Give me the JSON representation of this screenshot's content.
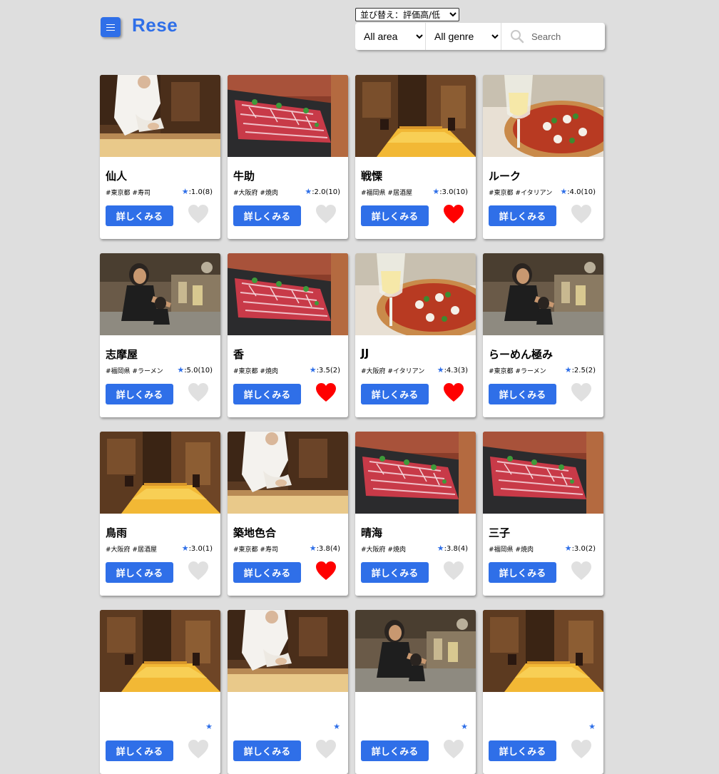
{
  "header": {
    "logo": "Rese",
    "sort_selected": "並び替え：評価高/低",
    "area_selected": "All area",
    "genre_selected": "All genre",
    "search_placeholder": "Search"
  },
  "detail_label": "詳しくみる",
  "colors": {
    "accent": "#2f6fe8",
    "heart_on": "#ff0000",
    "heart_off": "#e0e0e0"
  },
  "shops": [
    {
      "name": "仙人",
      "tags": "#東京都 #寿司",
      "score": ":1.0(8)",
      "photo": "sushi",
      "favorite": false
    },
    {
      "name": "牛助",
      "tags": "#大阪府 #焼肉",
      "score": ":2.0(10)",
      "photo": "yakiniku",
      "favorite": false
    },
    {
      "name": "戦慄",
      "tags": "#福岡県 #居酒屋",
      "score": ":3.0(10)",
      "photo": "izakaya",
      "favorite": true
    },
    {
      "name": "ルーク",
      "tags": "#東京都 #イタリアン",
      "score": ":4.0(10)",
      "photo": "italian",
      "favorite": false
    },
    {
      "name": "志摩屋",
      "tags": "#福岡県 #ラーメン",
      "score": ":5.0(10)",
      "photo": "ramen",
      "favorite": false
    },
    {
      "name": "香",
      "tags": "#東京都 #焼肉",
      "score": ":3.5(2)",
      "photo": "yakiniku",
      "favorite": true
    },
    {
      "name": "JJ",
      "tags": "#大阪府 #イタリアン",
      "score": ":4.3(3)",
      "photo": "italian",
      "favorite": true
    },
    {
      "name": "らーめん極み",
      "tags": "#東京都 #ラーメン",
      "score": ":2.5(2)",
      "photo": "ramen",
      "favorite": false
    },
    {
      "name": "鳥雨",
      "tags": "#大阪府 #居酒屋",
      "score": ":3.0(1)",
      "photo": "izakaya",
      "favorite": false
    },
    {
      "name": "築地色合",
      "tags": "#東京都 #寿司",
      "score": ":3.8(4)",
      "photo": "sushi",
      "favorite": true
    },
    {
      "name": "晴海",
      "tags": "#大阪府 #焼肉",
      "score": ":3.8(4)",
      "photo": "yakiniku",
      "favorite": false
    },
    {
      "name": "三子",
      "tags": "#福岡県 #焼肉",
      "score": ":3.0(2)",
      "photo": "yakiniku",
      "favorite": false
    },
    {
      "name": "",
      "tags": "",
      "score": "",
      "photo": "izakaya",
      "favorite": false
    },
    {
      "name": "",
      "tags": "",
      "score": "",
      "photo": "sushi",
      "favorite": false
    },
    {
      "name": "",
      "tags": "",
      "score": "",
      "photo": "ramen",
      "favorite": false
    },
    {
      "name": "",
      "tags": "",
      "score": "",
      "photo": "izakaya",
      "favorite": false
    }
  ]
}
